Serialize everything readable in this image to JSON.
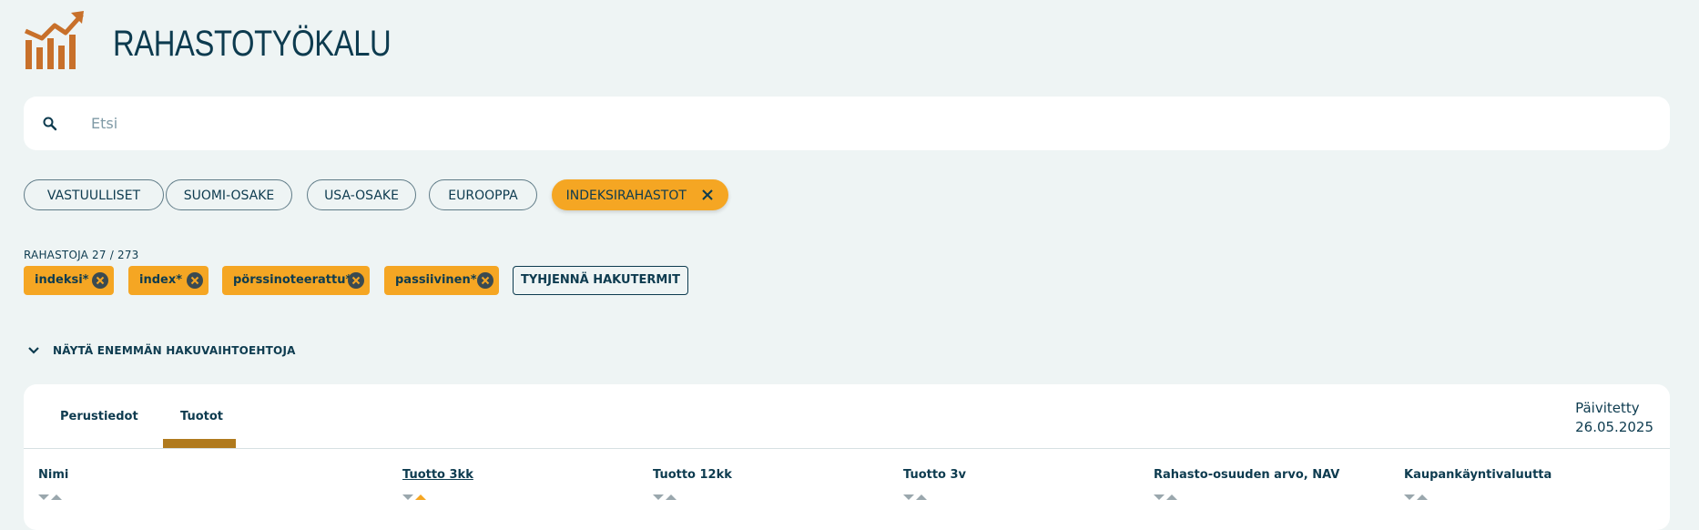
{
  "header": {
    "title": "RAHASTOTYÖKALU",
    "logo_icon": "rising-bar-chart-icon",
    "logo_color": "#c8702a"
  },
  "search": {
    "placeholder": "Etsi",
    "value": ""
  },
  "categories": [
    {
      "label": "VASTUULLISET",
      "active": false
    },
    {
      "label": "SUOMI-OSAKE",
      "active": false
    },
    {
      "label": "USA-OSAKE",
      "active": false
    },
    {
      "label": "EUROOPPA",
      "active": false
    },
    {
      "label": "INDEKSIRAHASTOT",
      "active": true
    }
  ],
  "results": {
    "count_label": "RAHASTOJA 27 / 273"
  },
  "search_terms": [
    "indeksi*",
    "index*",
    "pörssinoteerattu*",
    "passiivinen*"
  ],
  "clear_terms_label": "TYHJENNÄ HAKUTERMIT",
  "more_options_label": "NÄYTÄ ENEMMÄN HAKUVAIHTOEHTOJA",
  "tabs": [
    {
      "label": "Perustiedot",
      "active": false
    },
    {
      "label": "Tuotot",
      "active": true
    }
  ],
  "updated": {
    "label": "Päivitetty",
    "date": "26.05.2025"
  },
  "columns": [
    {
      "label": "Nimi",
      "sorted": false
    },
    {
      "label": "Tuotto 3kk",
      "sorted": true,
      "direction": "asc"
    },
    {
      "label": "Tuotto 12kk",
      "sorted": false
    },
    {
      "label": "Tuotto 3v",
      "sorted": false
    },
    {
      "label": "Rahasto-osuuden arvo, NAV",
      "sorted": false
    },
    {
      "label": "Kaupankäyntivaluutta",
      "sorted": false
    }
  ],
  "colors": {
    "accent": "#f5a623",
    "tab_underline": "#b07a1e",
    "text": "#0d3b4f",
    "background": "#eef4f4"
  }
}
